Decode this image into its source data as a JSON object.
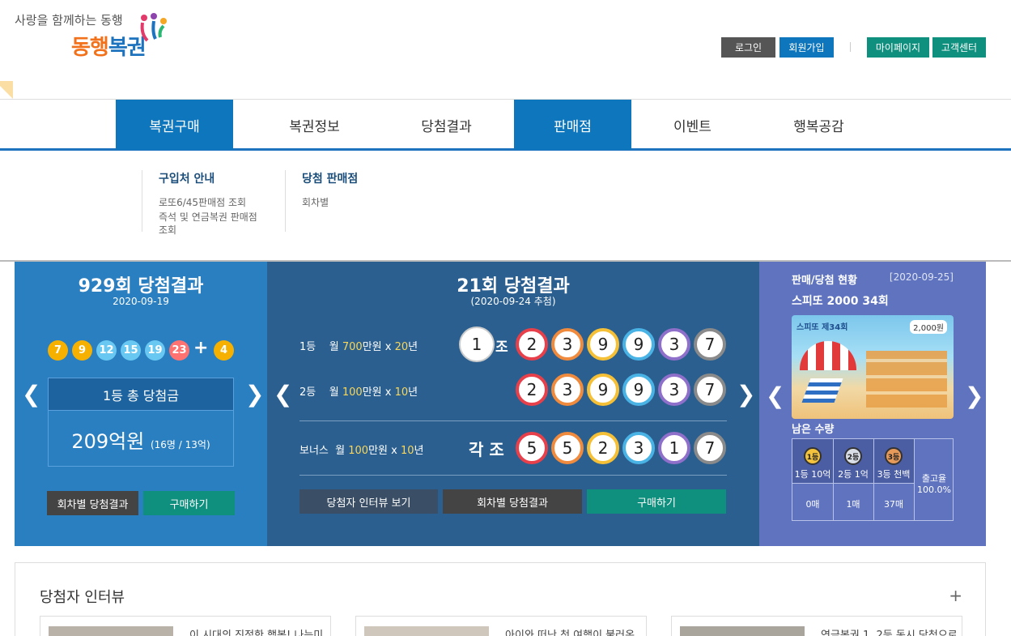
{
  "header": {
    "tagline": "사랑을 함께하는 동행",
    "logo_part1": "동행",
    "logo_part2": "복권",
    "buttons": [
      {
        "label": "로그인",
        "color": "#555555"
      },
      {
        "label": "회원가입",
        "color": "#0e76bc"
      },
      {
        "label": "마이페이지",
        "color": "#0f8f7d"
      },
      {
        "label": "고객센터",
        "color": "#0f8f7d"
      }
    ]
  },
  "gnb": [
    "복권구매",
    "복권정보",
    "당첨결과",
    "판매점",
    "이벤트",
    "행복공감"
  ],
  "submenu": {
    "col1": {
      "title": "구입처 안내",
      "links": [
        "로또6/45판매점 조회",
        "즉석 및 연금복권 판매점 조회"
      ]
    },
    "col2": {
      "title": "당첨 판매점",
      "links": [
        "회차별"
      ]
    }
  },
  "lotto": {
    "title": "929회 당첨결과",
    "date": "2020-09-19",
    "numbers": [
      "7",
      "9",
      "12",
      "15",
      "19",
      "23"
    ],
    "bonus": "4",
    "plus": "+",
    "prize_head": "1등 총 당첨금",
    "prize_amount": "209억원",
    "prize_detail": "(16명 / 13억)",
    "btn_results": "회차별 당첨결과",
    "btn_buy": "구매하기"
  },
  "pension": {
    "title": "21회 당첨결과",
    "date": "(2020-09-24 추첨)",
    "rank1": {
      "rank": "1등",
      "prefix": "월 ",
      "amount": "700",
      "unit": "만원 x ",
      "years": "20",
      "suffix": "년",
      "group": "1",
      "group_suffix": "조",
      "numbers": [
        "2",
        "3",
        "9",
        "9",
        "3",
        "7"
      ]
    },
    "rank2": {
      "rank": "2등",
      "prefix": "월 ",
      "amount": "100",
      "unit": "만원 x ",
      "years": "10",
      "suffix": "년",
      "numbers": [
        "2",
        "3",
        "9",
        "9",
        "3",
        "7"
      ]
    },
    "bonus": {
      "rank": "보너스",
      "prefix": "월 ",
      "amount": "100",
      "unit": "만원 x ",
      "years": "10",
      "suffix": "년",
      "group_label": "각 조",
      "numbers": [
        "5",
        "5",
        "2",
        "3",
        "1",
        "7"
      ]
    },
    "btn_interview": "당첨자 인터뷰 보기",
    "btn_results": "회차별 당첨결과",
    "btn_buy": "구매하기"
  },
  "speetto": {
    "title": "판매/당첨 현황",
    "date": "[2020-09-25]",
    "name": "스피또 2000 34회",
    "ticket_label": "스피또 제34회",
    "ticket_price": "2,000원",
    "remain_label": "남은 수량",
    "prizes": [
      {
        "medal": "1등",
        "label": "1등 10억",
        "count": "0매"
      },
      {
        "medal": "2등",
        "label": "2등 1억",
        "count": "1매"
      },
      {
        "medal": "3등",
        "label": "3등 천백",
        "count": "37매"
      }
    ],
    "ship_label": "출고율",
    "ship_rate": "100.0%"
  },
  "interview": {
    "title": "당첨자 인터뷰",
    "plus": "+",
    "cards": [
      "이 시대의 진정한 행복! 나는미",
      "아이와 떠난 첫 여행이 불러온",
      "연금복권 1, 2등 동시 당첨으로"
    ]
  },
  "arrows": {
    "left": "❮",
    "right": "❯"
  },
  "colors": {
    "lotto_panel": "#2a7fc1",
    "pension_panel": "#2a5f8f",
    "speetto_panel": "#5f73bf",
    "accent": "#0e76bc",
    "highlight": "#f9d75b"
  }
}
